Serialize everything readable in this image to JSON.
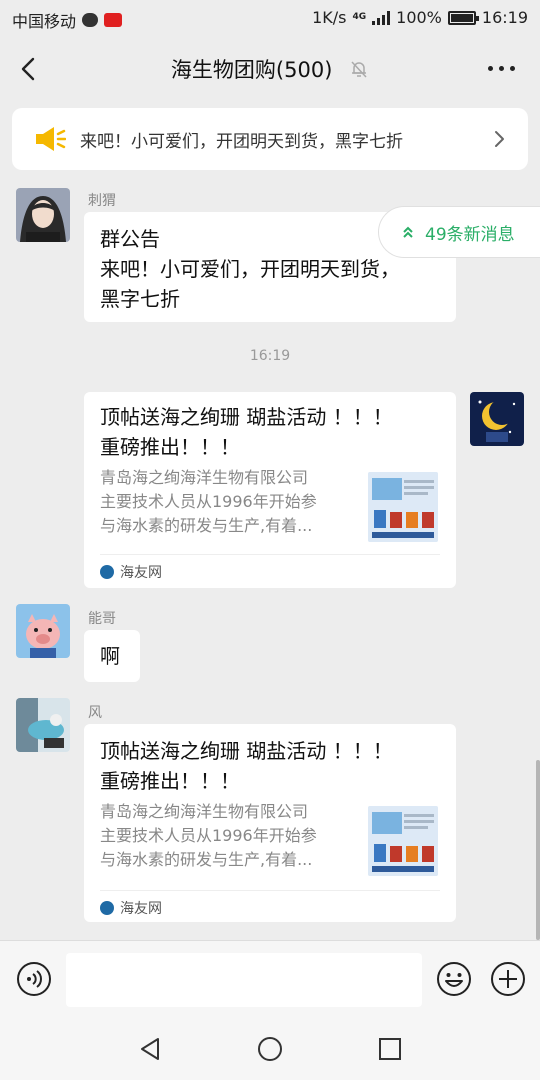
{
  "status_bar": {
    "carrier": "中国移动",
    "speed": "1K/s",
    "network": "4G",
    "battery": "100%",
    "battery_level": 1.0,
    "time": "16:19"
  },
  "header": {
    "title": "海生物团购(500)"
  },
  "notice": {
    "text": "来吧！小可爱们，开团明天到货，黑字七折"
  },
  "new_messages": {
    "label": "49条新消息"
  },
  "messages": [
    {
      "sender": "刺猬",
      "type": "text",
      "lines": [
        "群公告",
        "来吧！小可爱们，开团明天到货，",
        "黑字七折"
      ]
    },
    {
      "type": "time",
      "text": "16:19"
    },
    {
      "sender": "",
      "type": "link",
      "title_lines": [
        "顶帖送海之绚珊 瑚盐活动 ！！！",
        "重磅推出！！！"
      ],
      "desc_lines": [
        "青岛海之绚海洋生物有限公司",
        "主要技术人员从1996年开始参",
        "与海水素的研发与生产,有着..."
      ],
      "source": "海友网"
    },
    {
      "sender": "能哥",
      "type": "text",
      "lines": [
        "啊"
      ]
    },
    {
      "sender": "风",
      "type": "link",
      "title_lines": [
        "顶帖送海之绚珊 瑚盐活动 ！！！",
        "重磅推出！！！"
      ],
      "desc_lines": [
        "青岛海之绚海洋生物有限公司",
        "主要技术人员从1996年开始参",
        "与海水素的研发与生产,有着..."
      ],
      "source": "海友网"
    }
  ],
  "input": {
    "placeholder": "",
    "value": ""
  },
  "colors": {
    "accent_green": "#2aae67",
    "notice_icon": "#f5b800",
    "background": "#ededed"
  }
}
